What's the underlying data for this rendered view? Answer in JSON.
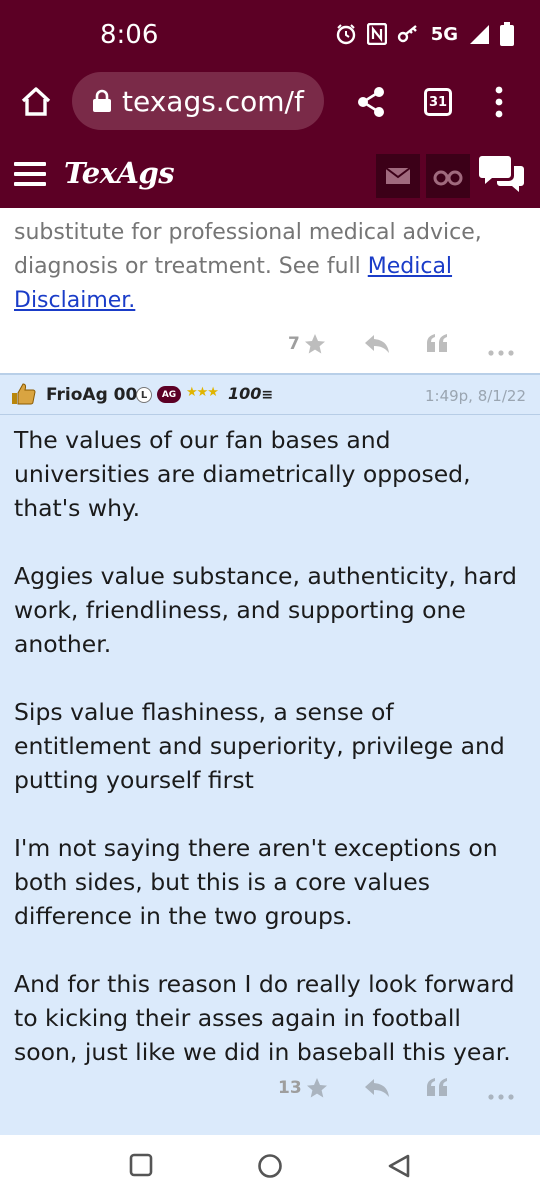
{
  "status_bar": {
    "time": "8:06",
    "network": "5G",
    "icons": [
      "alarm-icon",
      "nfc-icon",
      "key-icon",
      "signal-icon",
      "battery-icon"
    ]
  },
  "browser": {
    "url": "texags.com/f",
    "tab_count": "31",
    "icons": [
      "home-icon",
      "lock-icon",
      "share-icon",
      "tabs-icon",
      "more-vert-icon"
    ]
  },
  "site_header": {
    "logo": "TexAgs",
    "icons": [
      "hamburger-icon",
      "mail-icon",
      "binoculars-icon",
      "chat-icon"
    ]
  },
  "previous_post": {
    "text_before_link": "substitute for professional medical advice, diagnosis or treatment. See full ",
    "link_text": "Medical Disclaimer.",
    "star_count": "7"
  },
  "post": {
    "username": "FrioAg 00",
    "badge_l": "L",
    "badge_ag": "AG",
    "stars": "★★★",
    "badge_100": "100",
    "timestamp": "1:49p, 8/1/22",
    "paragraphs": [
      "The values of our fan bases and universities are diametrically opposed, that's why.",
      "Aggies value substance, authenticity, hard work, friendliness, and supporting one another.",
      "Sips value flashiness, a sense of entitlement and superiority, privilege and putting yourself first",
      "I'm not saying there aren't exceptions on both sides, but this is a core values difference in the two groups.",
      "And for this reason I do really look forward to kicking their asses again in football soon, just like we did in baseball this year."
    ],
    "star_count": "13"
  },
  "colors": {
    "maroon": "#5c0025",
    "post_bg": "#dbeafb",
    "link": "#1a3cc8"
  }
}
